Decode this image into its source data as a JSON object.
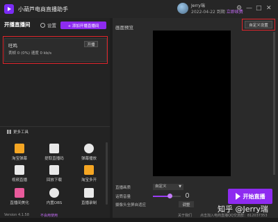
{
  "titlebar": {
    "app_title": "小葫芦电商直播助手",
    "user_name": "Jerry瑞",
    "expire_text": "2022-04-22 到期",
    "renew_label": "立即续费",
    "controls": [
      "⚙",
      "—",
      "□",
      "✕"
    ]
  },
  "left": {
    "live_room_title": "开播直播间",
    "settings_label": "设置",
    "add_button_label": "+ 添加开播直播间",
    "room": {
      "name": "旺鸣",
      "stats": "丢帧 0 (0%)   速度 0 kb/s",
      "start_label": "开播"
    },
    "tools_title": "更多工具",
    "tools": [
      {
        "label": "淘宝弹幕",
        "icon": "taobao-icon",
        "color": "#f5a623"
      },
      {
        "label": "提取直播码",
        "icon": "upload-icon",
        "color": "#ffffff"
      },
      {
        "label": "弹幕播放",
        "icon": "chat-icon",
        "color": "#ffffff"
      },
      {
        "label": "视频直播",
        "icon": "film-icon",
        "color": "#ffffff"
      },
      {
        "label": "回放下载",
        "icon": "download-icon",
        "color": "#ffffff"
      },
      {
        "label": "淘宝多开",
        "icon": "taobao-multi-icon",
        "color": "#f5a623"
      },
      {
        "label": "直播间美化",
        "icon": "beautify-icon",
        "color": "#e85a9b"
      },
      {
        "label": "内置OBS",
        "icon": "obs-icon",
        "color": "#ffffff"
      },
      {
        "label": "直播录制",
        "icon": "record-icon",
        "color": "#ffffff"
      }
    ]
  },
  "right": {
    "preview_title": "画面预览",
    "custom_settings_label": "自定义设置",
    "quality_label": "直播画质",
    "quality_value": "自定义",
    "volume_label": "话筒音量",
    "volume_level": 0.6,
    "camera_label": "摄像头全屏自适应",
    "adjust_label": "调整",
    "start_live_label": "开始直播"
  },
  "statusbar": {
    "version": "Version 4.1.58",
    "user_feedback": "不会用使用",
    "about": "关于我们",
    "qq_group": "点击加入电商直播QQ交流群：812037353"
  },
  "watermark": "知乎 @Jerry瑞",
  "colors": {
    "accent": "#8e2bf0",
    "highlight_frame": "#e0252b"
  }
}
